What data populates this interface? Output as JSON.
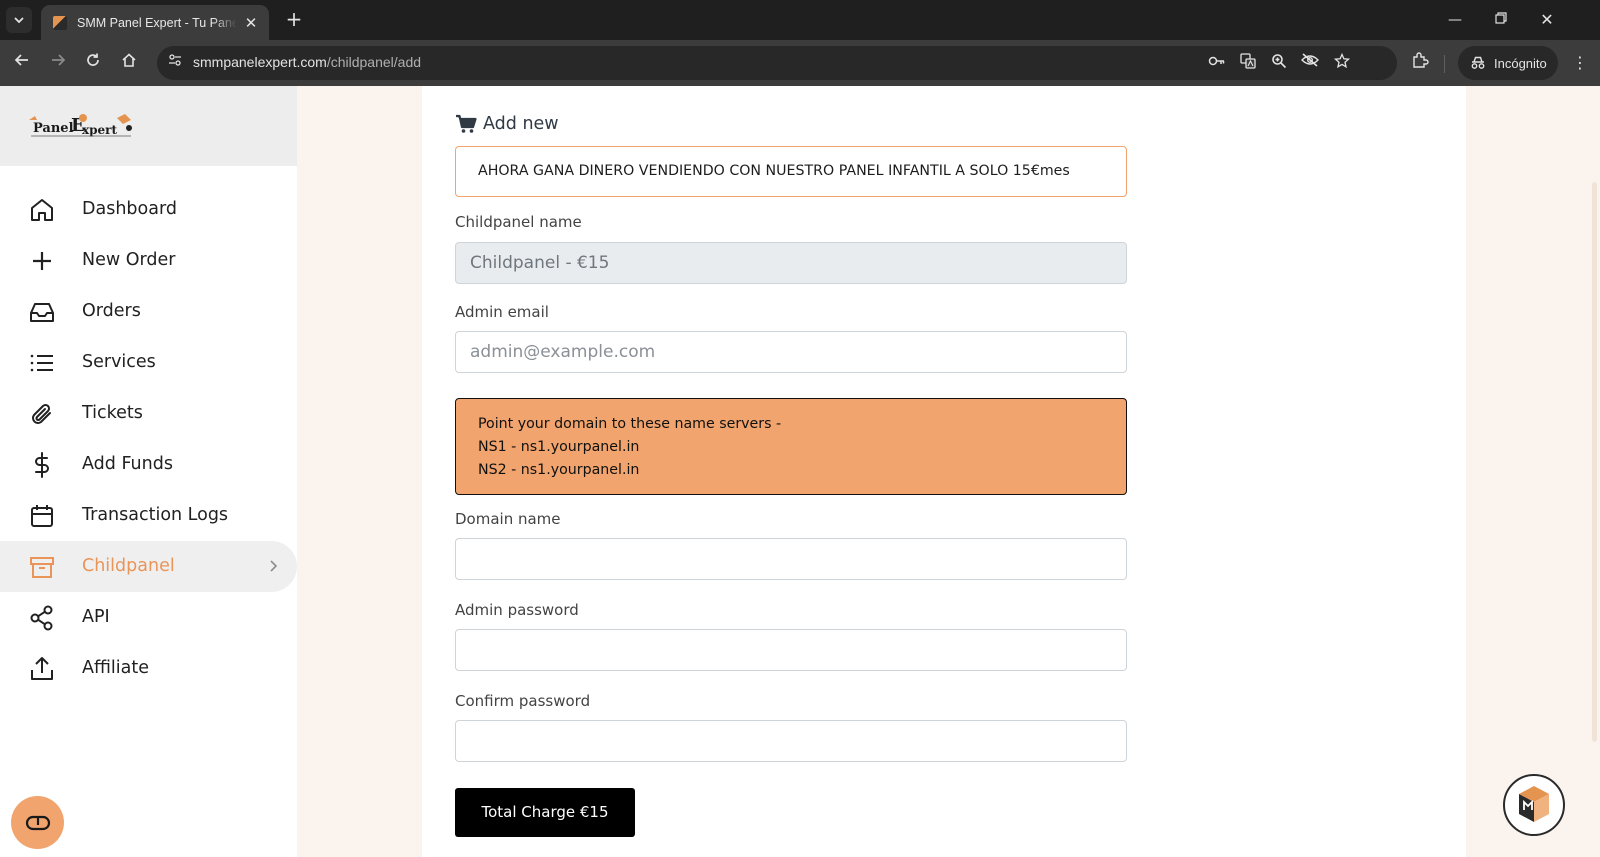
{
  "browser": {
    "tab_title": "SMM Panel Expert - Tu Panel de",
    "url_domain": "smmpanelexpert.com",
    "url_path": "/childpanel/add",
    "incognito_label": "Incógnito"
  },
  "sidebar": {
    "items": [
      {
        "label": "Dashboard",
        "icon": "home-icon"
      },
      {
        "label": "New Order",
        "icon": "plus-icon"
      },
      {
        "label": "Orders",
        "icon": "inbox-icon"
      },
      {
        "label": "Services",
        "icon": "list-icon"
      },
      {
        "label": "Tickets",
        "icon": "paperclip-icon"
      },
      {
        "label": "Add Funds",
        "icon": "dollar-icon"
      },
      {
        "label": "Transaction Logs",
        "icon": "calendar-icon"
      },
      {
        "label": "Childpanel",
        "icon": "archive-icon",
        "active": true
      },
      {
        "label": "API",
        "icon": "share-icon"
      },
      {
        "label": "Affiliate",
        "icon": "upload-icon"
      }
    ],
    "active_color": "#e9955a"
  },
  "form": {
    "heading": "Add new",
    "promo_text": "AHORA GANA DINERO VENDIENDO CON NUESTRO PANEL INFANTIL A SOLO 15€mes",
    "childpanel_name_label": "Childpanel name",
    "childpanel_name_value": "Childpanel - €15",
    "admin_email_label": "Admin email",
    "admin_email_placeholder": "admin@example.com",
    "nameservers": {
      "intro": "Point your domain to these name servers -",
      "ns1": "NS1 - ns1.yourpanel.in",
      "ns2": "NS2 - ns1.yourpanel.in"
    },
    "domain_name_label": "Domain name",
    "admin_password_label": "Admin password",
    "confirm_password_label": "Confirm password",
    "submit_label": "Total Charge €15"
  },
  "colors": {
    "accent": "#f1a46d",
    "page_bg": "#fbf4ee"
  }
}
